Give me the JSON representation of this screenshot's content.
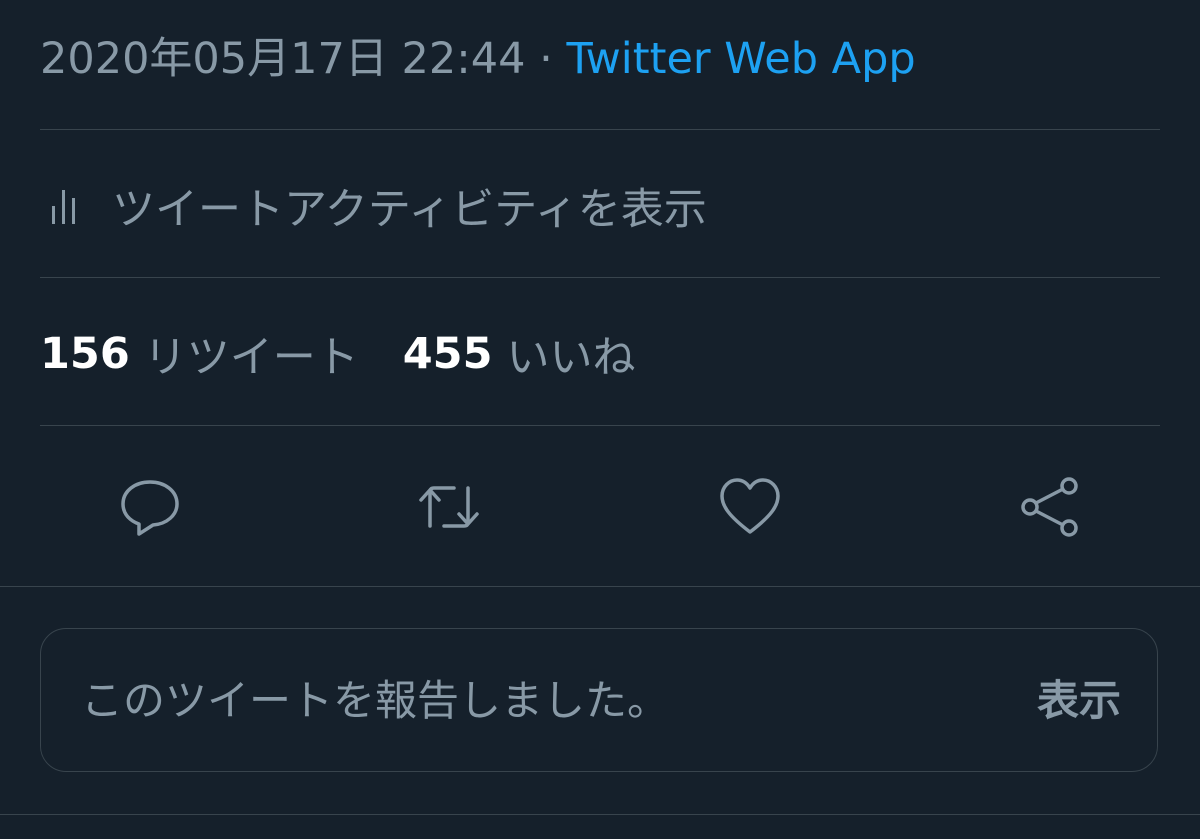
{
  "tweet_meta": {
    "datetime": "2020年05月17日 22:44",
    "separator": " · ",
    "source": "Twitter Web App"
  },
  "activity": {
    "label": "ツイートアクティビティを表示",
    "icon": "bar-chart-icon"
  },
  "stats": {
    "retweets_count": "156",
    "retweets_label": "リツイート",
    "likes_count": "455",
    "likes_label": "いいね"
  },
  "actions": [
    {
      "icon": "reply-icon"
    },
    {
      "icon": "retweet-icon"
    },
    {
      "icon": "like-icon"
    },
    {
      "icon": "share-icon"
    }
  ],
  "report": {
    "message": "このツイートを報告しました。",
    "show_label": "表示"
  },
  "colors": {
    "background": "#15202b",
    "accent": "#1da1f2",
    "secondary_text": "#8899a6",
    "divider": "#38444d"
  }
}
